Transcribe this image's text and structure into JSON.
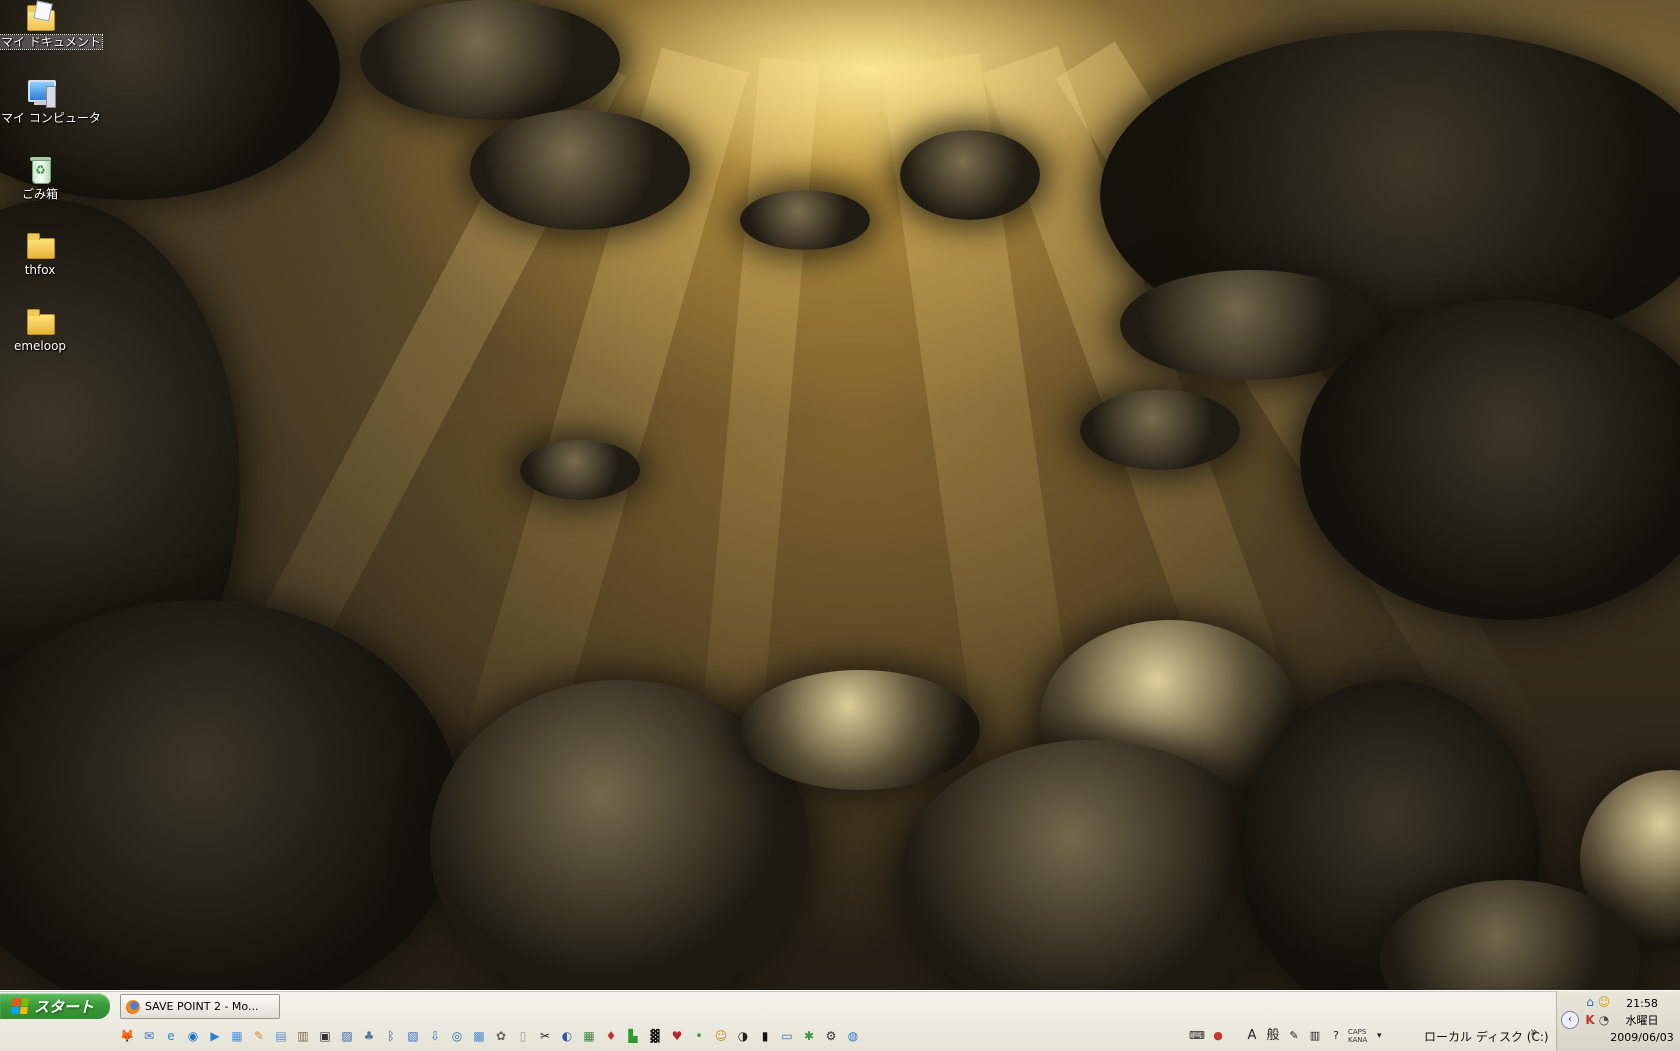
{
  "desktop": {
    "icons": [
      {
        "label": "マイ ドキュメント",
        "icon": "my-documents-icon"
      },
      {
        "label": "マイ コンピュータ",
        "icon": "my-computer-icon"
      },
      {
        "label": "ごみ箱",
        "icon": "recycle-bin-icon"
      },
      {
        "label": "thfox",
        "icon": "folder-icon"
      },
      {
        "label": "emeloop",
        "icon": "folder-icon"
      }
    ]
  },
  "taskbar": {
    "start_label": "スタート",
    "task_title": "SAVE POINT 2 - Mo...",
    "quick_launch": [
      {
        "icon": "firefox-icon",
        "glyph": "🦊"
      },
      {
        "icon": "thunderbird-icon",
        "glyph": "✉"
      },
      {
        "icon": "ie-icon",
        "glyph": "e"
      },
      {
        "icon": "browser-icon",
        "glyph": "◉"
      },
      {
        "icon": "media-player-icon",
        "glyph": "▶"
      },
      {
        "icon": "explorer-icon",
        "glyph": "▦"
      },
      {
        "icon": "tool-icon",
        "glyph": "✎"
      },
      {
        "icon": "notepad-icon",
        "glyph": "▤"
      },
      {
        "icon": "calendar-icon",
        "glyph": "▥"
      },
      {
        "icon": "cmd-icon",
        "glyph": "▣"
      },
      {
        "icon": "image-viewer-icon",
        "glyph": "▨"
      },
      {
        "icon": "network-icon",
        "glyph": "♣"
      },
      {
        "icon": "bluetooth-icon",
        "glyph": "ᛒ"
      },
      {
        "icon": "windows-icon",
        "glyph": "▧"
      },
      {
        "icon": "download-icon",
        "glyph": "⇩"
      },
      {
        "icon": "disc-icon",
        "glyph": "◎"
      },
      {
        "icon": "photo-icon",
        "glyph": "▩"
      },
      {
        "icon": "stamp-icon",
        "glyph": "✿"
      },
      {
        "icon": "page-icon",
        "glyph": "▯"
      },
      {
        "icon": "paint-icon",
        "glyph": "✂"
      },
      {
        "icon": "globe-icon",
        "glyph": "◐"
      },
      {
        "icon": "picture-icon",
        "glyph": "▦"
      },
      {
        "icon": "game-icon",
        "glyph": "♦"
      },
      {
        "icon": "chart-icon",
        "glyph": "▙"
      },
      {
        "icon": "matrix-icon",
        "glyph": "▓"
      },
      {
        "icon": "heart-icon",
        "glyph": "♥"
      },
      {
        "icon": "dot-icon",
        "glyph": "•"
      },
      {
        "icon": "face-icon",
        "glyph": "☺"
      },
      {
        "icon": "moon-icon",
        "glyph": "◑"
      },
      {
        "icon": "film-icon",
        "glyph": "▮"
      },
      {
        "icon": "window-icon",
        "glyph": "▭"
      },
      {
        "icon": "bug-icon",
        "glyph": "✱"
      },
      {
        "icon": "gear-icon",
        "glyph": "⚙"
      },
      {
        "icon": "earth-icon",
        "glyph": "◍"
      }
    ],
    "ime": {
      "keyboard_glyph": "⌨",
      "mode_a": "A",
      "mode_general": "般",
      "caps": "CAPS",
      "kana": "KANA"
    },
    "disk_label": "ローカル ディスク (C:)",
    "chevron": "»",
    "tray": {
      "collapse_glyph": "‹",
      "time": "21:58",
      "weekday": "水曜日",
      "date": "2009/06/03"
    }
  },
  "colors": {
    "start_green": "#3a9c3a",
    "taskbar_bg": "#e6e3d6"
  }
}
